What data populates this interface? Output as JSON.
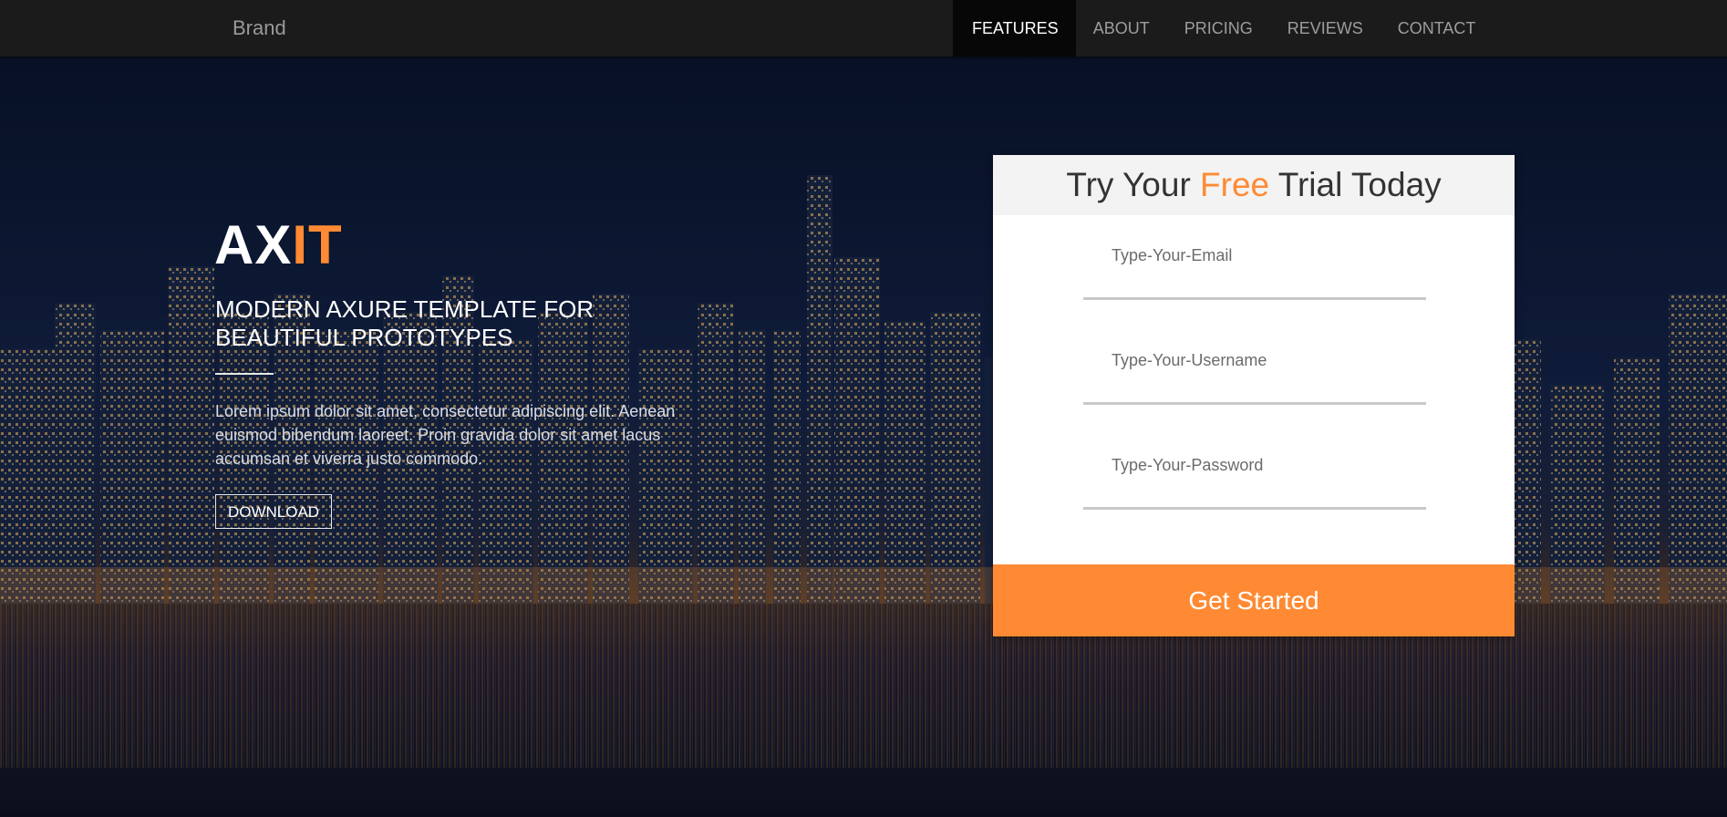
{
  "nav": {
    "brand": "Brand",
    "items": [
      {
        "label": "FEATURES",
        "active": true
      },
      {
        "label": "ABOUT"
      },
      {
        "label": "PRICING"
      },
      {
        "label": "REVIEWS"
      },
      {
        "label": "CONTACT"
      }
    ]
  },
  "hero": {
    "title_main": "AX",
    "title_accent": "IT",
    "subtitle_line1": "MODERN AXURE TEMPLATE FOR",
    "subtitle_line2": "BEAUTIFUL PROTOTYPES",
    "body": "Lorem ipsum dolor sit amet, consectetur adipiscing elit. Aenean euismod bibendum laoreet. Proin gravida dolor sit amet lacus accumsan et viverra justo commodo.",
    "download_label": "DOWNLOAD"
  },
  "trial": {
    "title_before": "Try Your ",
    "title_accent": "Free",
    "title_after": " Trial Today",
    "email_placeholder": "Type-Your-Email",
    "username_placeholder": "Type-Your-Username",
    "password_placeholder": "Type-Your-Password",
    "cta_label": "Get Started"
  },
  "colors": {
    "accent": "#ff8a33",
    "navbar": "#1b1b1b",
    "nav_active": "#070707",
    "card_header": "#f3f3f3"
  }
}
